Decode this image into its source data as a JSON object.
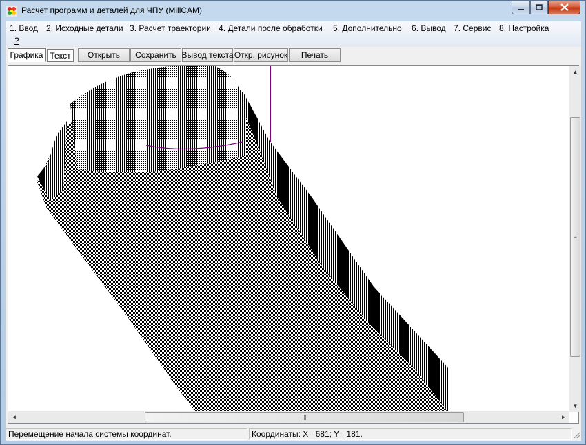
{
  "window": {
    "title": "Расчет программ и деталей для ЧПУ (MillCAM)",
    "controls": {
      "minimize": "—",
      "maximize": "□",
      "close": "✕"
    }
  },
  "menu": {
    "items": [
      {
        "accel": "1",
        "label": ". Ввод"
      },
      {
        "accel": "2",
        "label": ". Исходные детали"
      },
      {
        "accel": "3",
        "label": ". Расчет траектории"
      },
      {
        "accel": "4",
        "label": ". Детали после обработки"
      },
      {
        "accel": "5",
        "label": ". Дополнительно"
      },
      {
        "accel": "6",
        "label": ". Вывод"
      },
      {
        "accel": "7",
        "label": ". Сервис"
      },
      {
        "accel": "8",
        "label": ". Настройка"
      },
      {
        "accel": "?",
        "label": ""
      }
    ]
  },
  "toolbar": {
    "tabs": [
      {
        "label": "Графика",
        "active": true
      },
      {
        "label": "Текст",
        "active": false
      }
    ],
    "buttons": [
      {
        "label": "Открыть"
      },
      {
        "label": "Сохранить"
      },
      {
        "label": "Вывод текста"
      },
      {
        "label": "Откр. рисунок"
      },
      {
        "label": "Печать"
      }
    ]
  },
  "scrollbars": {
    "up_arrow": "▲",
    "down_arrow": "▼",
    "left_arrow": "◄",
    "right_arrow": "►",
    "grip": "≡",
    "hgrip": "|||"
  },
  "status": {
    "message": "Перемещение начала системы координат.",
    "coords": "Координаты: X=     681;  Y=      181."
  },
  "colors": {
    "axis_line": "#800080",
    "mesh": "#000000"
  }
}
